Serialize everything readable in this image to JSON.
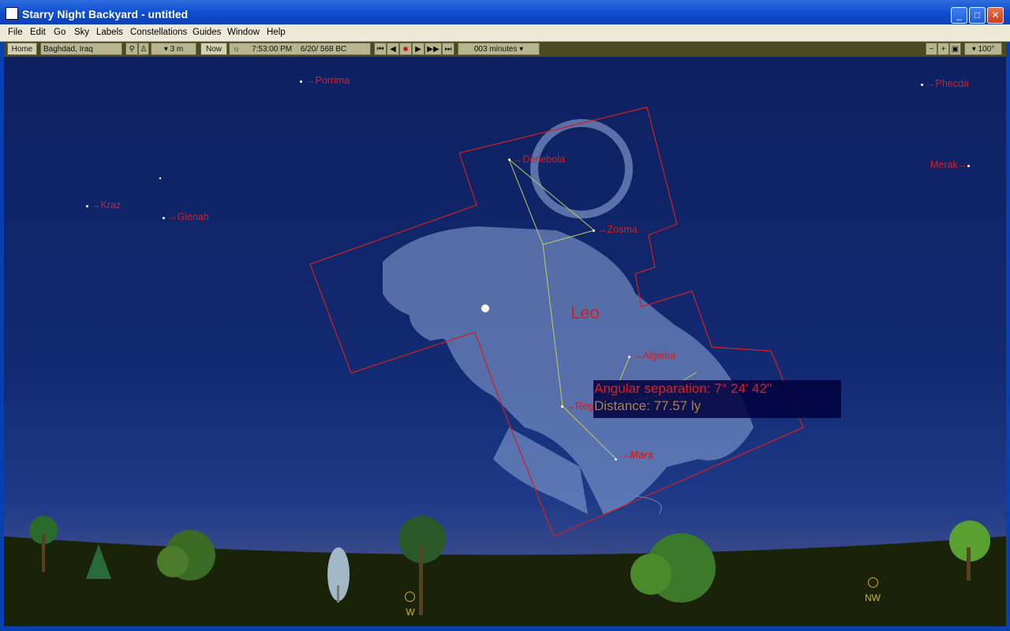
{
  "window": {
    "title": "Starry Night Backyard - untitled"
  },
  "menu": [
    "File",
    "Edit",
    "Go",
    "Sky",
    "Labels",
    "Constellations",
    "Guides",
    "Window",
    "Help"
  ],
  "toolbar": {
    "home_label": "Home",
    "location_value": "Baghdad, Iraq",
    "elevation_value": "3 m",
    "now_label": "Now",
    "time_value": "7:53:00 PM",
    "date_value": "6/20/  568 BC",
    "timestep_value": "003 minutes",
    "fov_value": "100°"
  },
  "sky": {
    "constellation_name": "Leo",
    "star_labels": {
      "porrima": "Porrima",
      "phecda": "Phecda",
      "denebola": "Denebola",
      "merak": "Merak",
      "kraz": "Kraz",
      "gienah": "Gienah",
      "zosma": "Zosma",
      "algieba": "Algieba",
      "regulus": "Regu",
      "mars": "Mars"
    },
    "angular_separation": "Angular separation: 7° 24' 42\"",
    "distance": "Distance: 77.57 ly",
    "directions": {
      "west": "W",
      "northwest": "NW"
    }
  },
  "colors": {
    "sky_top": "#0d2060",
    "label_red": "#d02020",
    "ground": "#1a2208",
    "titlebar": "#0f4fd0"
  }
}
